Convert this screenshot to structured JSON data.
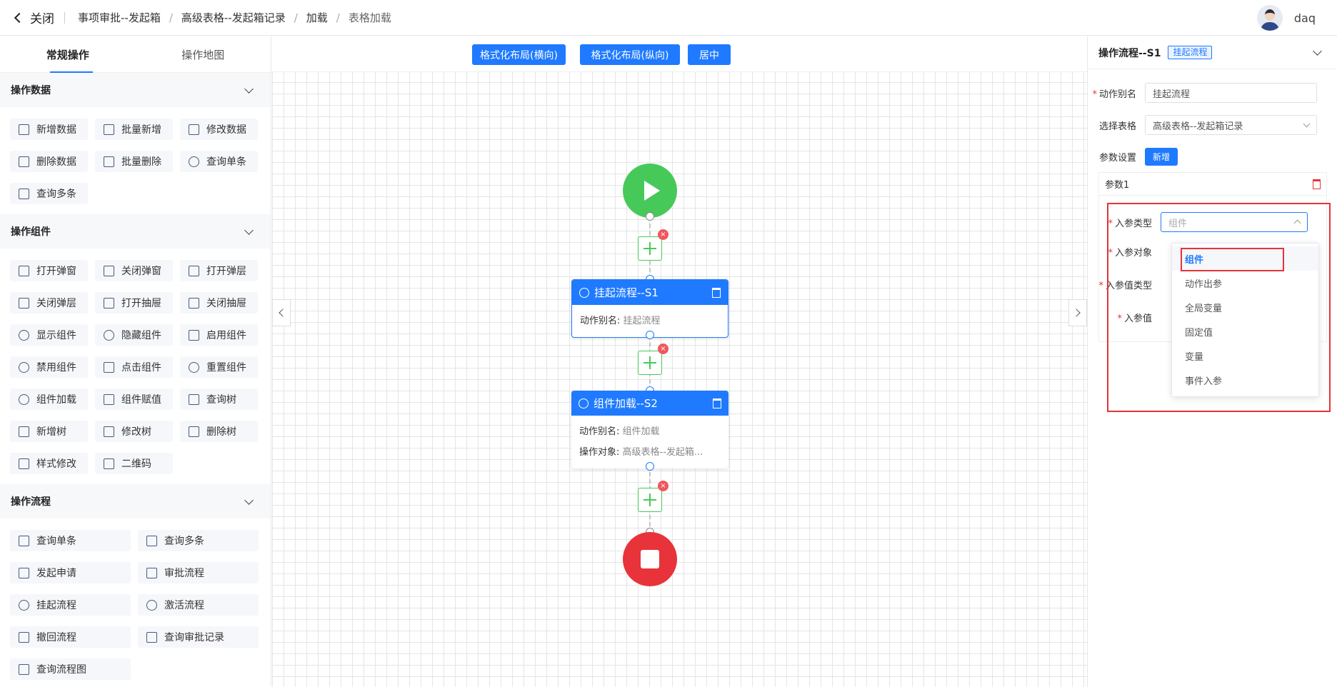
{
  "header": {
    "close_label": "关闭",
    "breadcrumb": [
      "事项审批--发起箱",
      "高级表格--发起箱记录",
      "加载",
      "表格加载"
    ],
    "username": "daq"
  },
  "left": {
    "tabs": [
      "常规操作",
      "操作地图"
    ],
    "sections": [
      {
        "title": "操作数据",
        "items": [
          "新增数据",
          "批量新增",
          "修改数据",
          "删除数据",
          "批量删除",
          "查询单条",
          "查询多条"
        ]
      },
      {
        "title": "操作组件",
        "items": [
          "打开弹窗",
          "关闭弹窗",
          "打开弹层",
          "关闭弹层",
          "打开抽屉",
          "关闭抽屉",
          "显示组件",
          "隐藏组件",
          "启用组件",
          "禁用组件",
          "点击组件",
          "重置组件",
          "组件加载",
          "组件赋值",
          "查询树",
          "新增树",
          "修改树",
          "删除树",
          "样式修改",
          "二维码"
        ]
      },
      {
        "title": "操作流程",
        "items": [
          "查询单条",
          "查询多条",
          "发起申请",
          "审批流程",
          "挂起流程",
          "激活流程",
          "撤回流程",
          "查询审批记录",
          "查询流程图"
        ]
      }
    ]
  },
  "toolbar": {
    "layout_h": "格式化布局(横向)",
    "layout_v": "格式化布局(纵向)",
    "center": "居中"
  },
  "flow": {
    "node1": {
      "title": "挂起流程--S1",
      "alias_label": "动作别名:",
      "alias_value": "挂起流程"
    },
    "node2": {
      "title": "组件加载--S2",
      "alias_label": "动作别名:",
      "alias_value": "组件加载",
      "target_label": "操作对象:",
      "target_value": "高级表格--发起箱..."
    },
    "delete_badge": "×"
  },
  "right": {
    "title": "操作流程--S1",
    "tag": "挂起流程",
    "alias_label": "动作别名",
    "alias_value": "挂起流程",
    "table_label": "选择表格",
    "table_value": "高级表格--发起箱记录",
    "params_label": "参数设置",
    "add_label": "新增",
    "param_title": "参数1",
    "in_type_label": "入参类型",
    "in_type_placeholder": "组件",
    "in_target_label": "入参对象",
    "in_value_type_label": "入参值类型",
    "in_value_label": "入参值",
    "required_mark": "*",
    "options": [
      "组件",
      "动作出参",
      "全局变量",
      "固定值",
      "变量",
      "事件入参"
    ],
    "selected_option": "组件"
  },
  "colors": {
    "primary": "#1f7aff",
    "start": "#47c95a",
    "stop": "#e8333a",
    "highlight": "#e5333a"
  }
}
